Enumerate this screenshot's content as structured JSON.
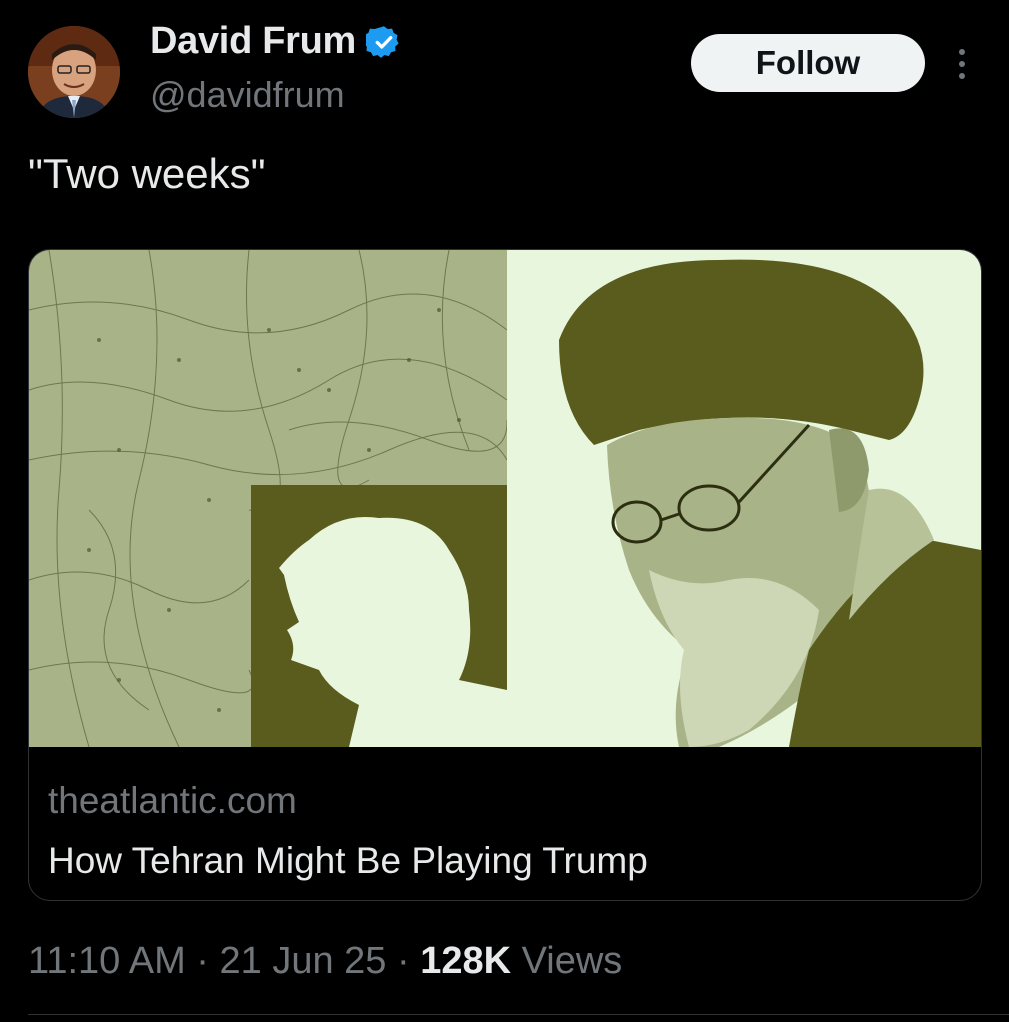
{
  "author": {
    "display_name": "David Frum",
    "handle": "@davidfrum",
    "verified_color": "#1d9bf0"
  },
  "actions": {
    "follow_label": "Follow"
  },
  "tweet": {
    "text": "\"Two weeks\""
  },
  "card": {
    "domain": "theatlantic.com",
    "title": "How Tehran Might Be Playing Trump",
    "image_palette": {
      "map": "#a9b388",
      "dark": "#5a5c1e",
      "light": "#e8f6de"
    }
  },
  "meta": {
    "time": "11:10 AM",
    "separator": " · ",
    "date": "21 Jun 25",
    "views_count": "128K",
    "views_label": " Views"
  }
}
